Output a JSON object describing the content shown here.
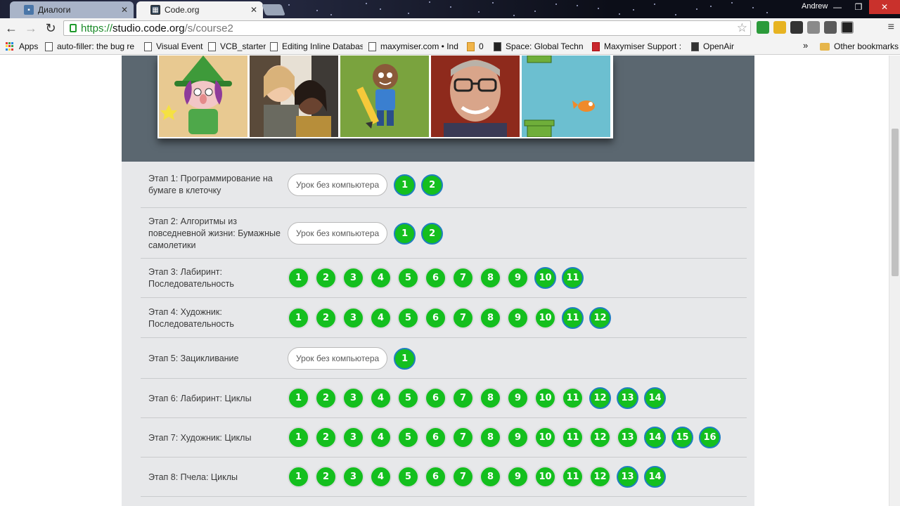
{
  "browser": {
    "tabs": [
      {
        "title": "Диалоги",
        "active": false,
        "favicon": "chat-icon"
      },
      {
        "title": "Code.org",
        "active": true,
        "favicon": "codeorg-icon"
      }
    ],
    "profile_name": "Andrew",
    "url": {
      "scheme": "https://",
      "host": "studio.code.org",
      "path": "/s/course2"
    },
    "bookmarks": [
      {
        "label": "Apps",
        "icon": "apps-grid-icon"
      },
      {
        "label": "auto-filler: the bug re",
        "icon": "page-icon"
      },
      {
        "label": "Visual Event",
        "icon": "page-icon"
      },
      {
        "label": "VCB_starter",
        "icon": "page-icon"
      },
      {
        "label": "Editing Inline Databas",
        "icon": "page-icon"
      },
      {
        "label": "maxymiser.com • Inde",
        "icon": "page-icon"
      },
      {
        "label": "0",
        "icon": "page-icon"
      },
      {
        "label": "Space: Global Technic",
        "icon": "page-icon"
      },
      {
        "label": "Maxymiser Support : ",
        "icon": "page-icon"
      },
      {
        "label": "OpenAir",
        "icon": "page-icon"
      }
    ],
    "overflow_label": "»",
    "other_bookmarks": "Other bookmarks"
  },
  "stages": [
    {
      "name": "Этап 1: Программирование на бумаге в клеточку",
      "unplugged": "Урок без компьютера",
      "levels": [
        "1",
        "2"
      ],
      "blue": [
        "1",
        "2"
      ]
    },
    {
      "name": "Этап 2: Алгоритмы из повседневной жизни: Бумажные самолетики",
      "unplugged": "Урок без компьютера",
      "levels": [
        "1",
        "2"
      ],
      "blue": [
        "1",
        "2"
      ]
    },
    {
      "name": "Этап 3: Лабиринт: Последовательность",
      "unplugged": "",
      "levels": [
        "1",
        "2",
        "3",
        "4",
        "5",
        "6",
        "7",
        "8",
        "9",
        "10",
        "11"
      ],
      "blue": [
        "10",
        "11"
      ]
    },
    {
      "name": "Этап 4: Художник: Последовательность",
      "unplugged": "",
      "levels": [
        "1",
        "2",
        "3",
        "4",
        "5",
        "6",
        "7",
        "8",
        "9",
        "10",
        "11",
        "12"
      ],
      "blue": [
        "11",
        "12"
      ]
    },
    {
      "name": "Этап 5: Зацикливание",
      "unplugged": "Урок без компьютера",
      "levels": [
        "1"
      ],
      "blue": [
        "1"
      ]
    },
    {
      "name": "Этап 6: Лабиринт: Циклы",
      "unplugged": "",
      "levels": [
        "1",
        "2",
        "3",
        "4",
        "5",
        "6",
        "7",
        "8",
        "9",
        "10",
        "11",
        "12",
        "13",
        "14"
      ],
      "blue": [
        "12",
        "13",
        "14"
      ]
    },
    {
      "name": "Этап 7: Художник: Циклы",
      "unplugged": "",
      "levels": [
        "1",
        "2",
        "3",
        "4",
        "5",
        "6",
        "7",
        "8",
        "9",
        "10",
        "11",
        "12",
        "13",
        "14",
        "15",
        "16"
      ],
      "blue": [
        "14",
        "15",
        "16"
      ]
    },
    {
      "name": "Этап 8: Пчела: Циклы",
      "unplugged": "",
      "levels": [
        "1",
        "2",
        "3",
        "4",
        "5",
        "6",
        "7",
        "8",
        "9",
        "10",
        "11",
        "12",
        "13",
        "14"
      ],
      "blue": [
        "13",
        "14"
      ]
    }
  ],
  "colors": {
    "level_green": "#14bf1e",
    "assessment_ring": "#1f7fbf",
    "hero_bg": "#5b6770",
    "main_bg": "#e7e8ea"
  }
}
